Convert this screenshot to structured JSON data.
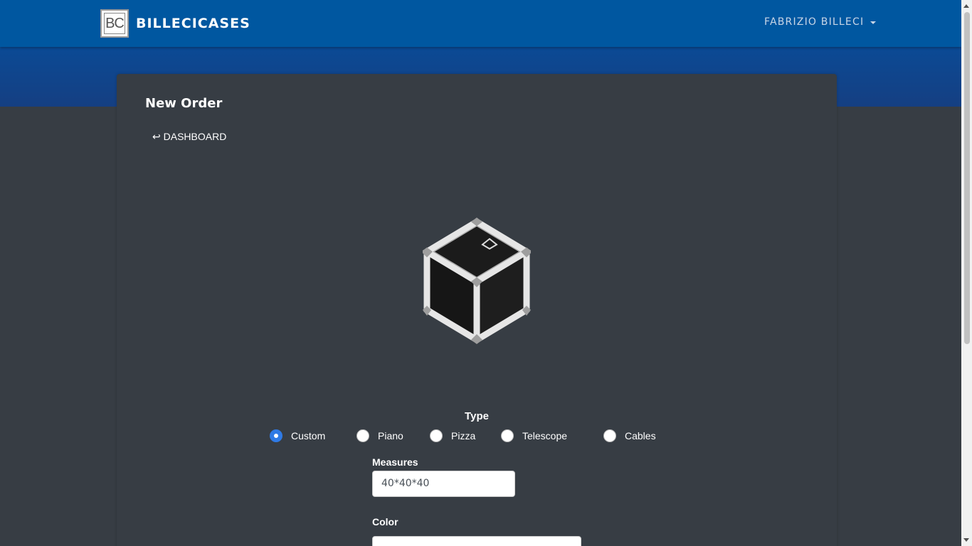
{
  "navbar": {
    "logo_text": "BC",
    "brand": "BILLECICASES",
    "user": "FABRIZIO BILLECI"
  },
  "page": {
    "title": "New Order",
    "back_link": "↩ DASHBOARD"
  },
  "form": {
    "type_label": "Type",
    "types": [
      {
        "label": "Custom",
        "checked": true
      },
      {
        "label": "Piano",
        "checked": false
      },
      {
        "label": "Pizza",
        "checked": false
      },
      {
        "label": "Telescope",
        "checked": false
      },
      {
        "label": "Cables",
        "checked": false
      }
    ],
    "measures_label": "Measures",
    "measures_value": "40*40*40",
    "color_label": "Color",
    "color_value": ""
  },
  "colors": {
    "navbar": "#0057a0",
    "background": "#373d44",
    "accent": "#2f7ae5"
  }
}
